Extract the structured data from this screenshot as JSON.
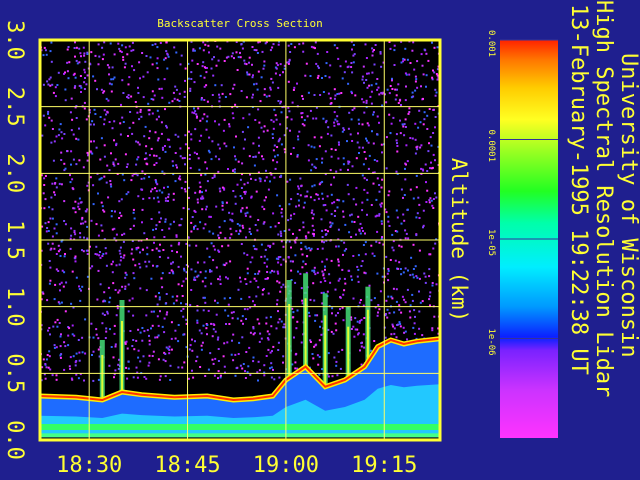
{
  "chart_data": {
    "type": "heatmap",
    "title": "Backscatter Cross Section",
    "ylabel": "Altitude (km)",
    "y_ticks": [
      "0.0",
      "0.5",
      "1.0",
      "1.5",
      "2.0",
      "2.5",
      "3.0"
    ],
    "y_tick_values": [
      0.0,
      0.5,
      1.0,
      1.5,
      2.0,
      2.5,
      3.0
    ],
    "ylim": [
      0.0,
      3.0
    ],
    "x_ticks": [
      "18:30",
      "18:45",
      "19:00",
      "19:15"
    ],
    "x_tick_values_min": [
      1110,
      1125,
      1140,
      1155
    ],
    "xlim_min": [
      1102.5,
      1163.5
    ],
    "colorbar": {
      "scale": "log",
      "range": [
        1e-07,
        0.001
      ],
      "ticks": [
        "0.001",
        "0.0001",
        "1e-05",
        "1e-06"
      ],
      "tick_values": [
        0.001,
        0.0001,
        1e-05,
        1e-06
      ]
    },
    "boundary_layer_top_km": [
      [
        1102.5,
        0.33
      ],
      [
        1108,
        0.32
      ],
      [
        1112,
        0.3
      ],
      [
        1115,
        0.36
      ],
      [
        1118,
        0.34
      ],
      [
        1123,
        0.32
      ],
      [
        1128,
        0.33
      ],
      [
        1132,
        0.3
      ],
      [
        1135,
        0.31
      ],
      [
        1138,
        0.33
      ],
      [
        1140,
        0.45
      ],
      [
        1143,
        0.55
      ],
      [
        1146,
        0.4
      ],
      [
        1149,
        0.45
      ],
      [
        1152,
        0.55
      ],
      [
        1154,
        0.7
      ],
      [
        1156,
        0.75
      ],
      [
        1158,
        0.72
      ],
      [
        1160,
        0.74
      ],
      [
        1163.5,
        0.76
      ]
    ],
    "plumes": [
      {
        "time_min": 1115,
        "top_km": 1.05
      },
      {
        "time_min": 1112,
        "top_km": 0.75
      },
      {
        "time_min": 1140.5,
        "top_km": 1.2
      },
      {
        "time_min": 1143,
        "top_km": 1.25
      },
      {
        "time_min": 1146,
        "top_km": 1.1
      },
      {
        "time_min": 1149.5,
        "top_km": 1.0
      },
      {
        "time_min": 1152.5,
        "top_km": 1.15
      }
    ],
    "grid": true
  },
  "side_title": {
    "line1": "University of Wisconsin",
    "line2": "High Spectral Resolution Lidar",
    "line3": "13-February-1995 19:22:38 UT"
  },
  "colors": {
    "background": "#1f1f8f",
    "frame": "#ffff33",
    "grid": "#ffff66",
    "text": "#ffff33"
  }
}
